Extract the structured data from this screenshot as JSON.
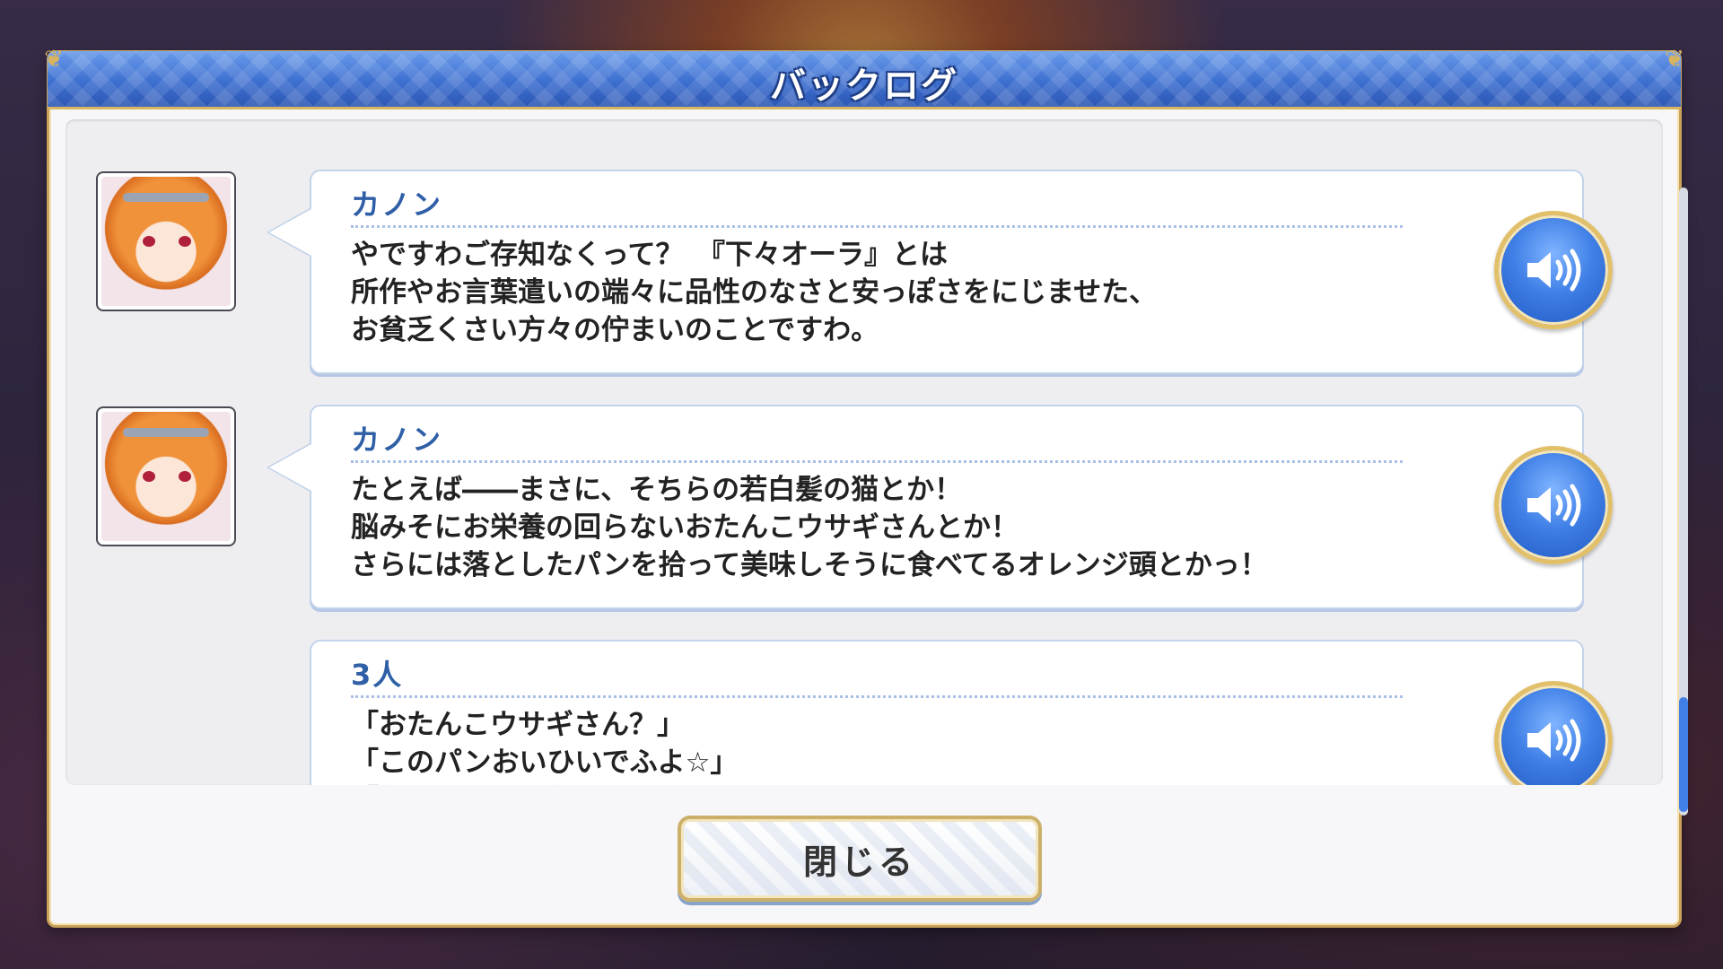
{
  "dialog": {
    "title": "バックログ",
    "close_label": "閉じる"
  },
  "entries": [
    {
      "speaker": "カノン",
      "text": "やですわご存知なくって？　『下々オーラ』とは\n所作やお言葉遣いの端々に品性のなさと安っぽさをにじませた、\nお貧乏くさい方々の佇まいのことですわ。",
      "has_avatar": true,
      "voice_icon": "speaker-icon"
    },
    {
      "speaker": "カノン",
      "text": "たとえば――まさに、そちらの若白髪の猫とか！\n脳みそにお栄養の回らないおたんこウサギさんとか！\nさらには落としたパンを拾って美味しそうに食べてるオレンジ頭とかっ！",
      "has_avatar": true,
      "voice_icon": "speaker-icon"
    },
    {
      "speaker": "3人",
      "text": "「おたんこウサギさん？」\n「このパンおいひいでふよ☆」\n「何よあんた失礼ねっ！？」",
      "has_avatar": false,
      "voice_icon": "speaker-icon"
    }
  ],
  "colors": {
    "title_bar": "#3d6fd0",
    "gold_border": "#c9a35b",
    "speaker_name": "#2f5fa6",
    "voice_button": "#3f7fe6"
  }
}
